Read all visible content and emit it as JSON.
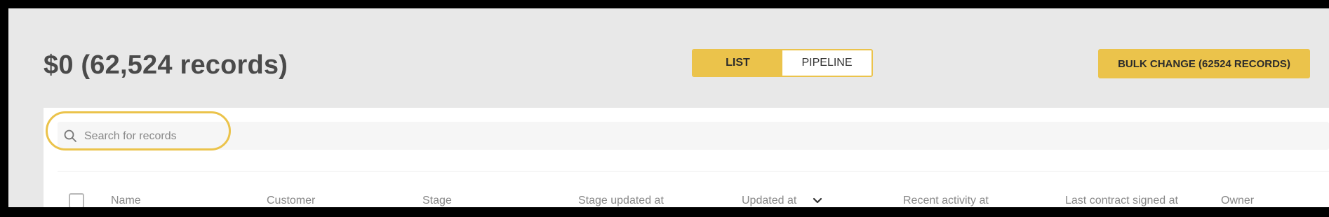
{
  "summary": {
    "title": "$0 (62,524 records)"
  },
  "view_toggle": {
    "list_label": "LIST",
    "pipeline_label": "PIPELINE",
    "selected": "LIST"
  },
  "bulk_change": {
    "label": "BULK CHANGE (62524 RECORDS)"
  },
  "search": {
    "placeholder": "Search for records",
    "value": ""
  },
  "table": {
    "columns": [
      "Name",
      "Customer",
      "Stage",
      "Stage updated at",
      "Updated at",
      "Recent activity at",
      "Last contract signed at",
      "Owner"
    ],
    "sorted_column": "Updated at"
  },
  "colors": {
    "accent": "#ebc34b",
    "background": "#e8e8e8",
    "panel": "#ffffff"
  }
}
